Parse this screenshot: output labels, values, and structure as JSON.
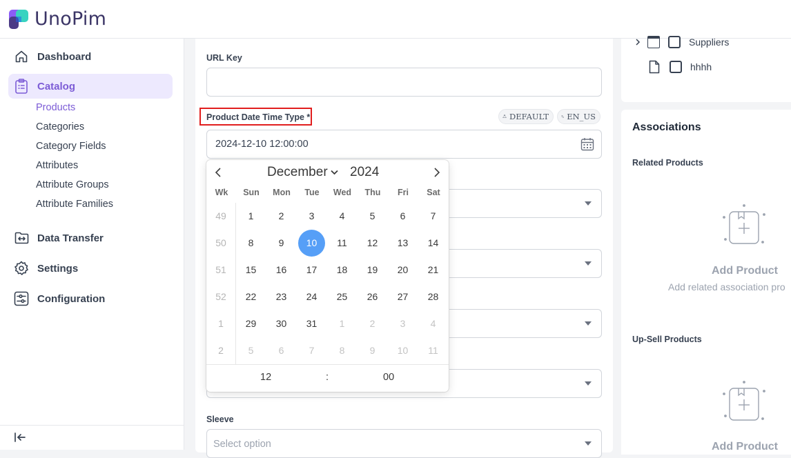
{
  "app": {
    "name": "UnoPim"
  },
  "sidebar": {
    "items": [
      {
        "label": "Dashboard",
        "icon": "home-icon"
      },
      {
        "label": "Catalog",
        "icon": "clipboard-list-icon",
        "active": true,
        "children": [
          {
            "label": "Products",
            "active": true
          },
          {
            "label": "Categories"
          },
          {
            "label": "Category Fields"
          },
          {
            "label": "Attributes"
          },
          {
            "label": "Attribute Groups"
          },
          {
            "label": "Attribute Families"
          }
        ]
      },
      {
        "label": "Data Transfer",
        "icon": "folder-arrows-icon"
      },
      {
        "label": "Settings",
        "icon": "gear-icon"
      },
      {
        "label": "Configuration",
        "icon": "sliders-icon"
      }
    ],
    "collapse_icon": "collapse-left-icon"
  },
  "form": {
    "url_key": {
      "label": "URL Key",
      "value": ""
    },
    "date_time": {
      "label": "Product Date Time Type",
      "required_mark": "*",
      "value": "2024-12-10 12:00:00",
      "badges": {
        "channel": "DEFAULT",
        "locale": "EN_US"
      }
    },
    "sleeve": {
      "label": "Sleeve",
      "placeholder": "Select option"
    }
  },
  "calendar": {
    "month": "December",
    "year": "2024",
    "weekdays": [
      "Wk",
      "Sun",
      "Mon",
      "Tue",
      "Wed",
      "Thu",
      "Fri",
      "Sat"
    ],
    "weeks": [
      {
        "wk": "49",
        "days": [
          "1",
          "2",
          "3",
          "4",
          "5",
          "6",
          "7"
        ]
      },
      {
        "wk": "50",
        "days": [
          "8",
          "9",
          "10",
          "11",
          "12",
          "13",
          "14"
        ]
      },
      {
        "wk": "51",
        "days": [
          "15",
          "16",
          "17",
          "18",
          "19",
          "20",
          "21"
        ]
      },
      {
        "wk": "52",
        "days": [
          "22",
          "23",
          "24",
          "25",
          "26",
          "27",
          "28"
        ]
      },
      {
        "wk": "1",
        "days": [
          "29",
          "30",
          "31",
          "1",
          "2",
          "3",
          "4"
        ]
      },
      {
        "wk": "2",
        "days": [
          "5",
          "6",
          "7",
          "8",
          "9",
          "10",
          "11"
        ]
      }
    ],
    "selected_day": "10",
    "time": {
      "hour": "12",
      "separator": ":",
      "minute": "00"
    }
  },
  "tree": {
    "items": [
      {
        "label": "Suppliers",
        "expandable": true
      },
      {
        "label": "hhhh",
        "expandable": false
      }
    ]
  },
  "associations": {
    "title": "Associations",
    "related": {
      "label": "Related Products",
      "add_label": "Add Product",
      "add_desc": "Add related association pro"
    },
    "upsell": {
      "label": "Up-Sell Products",
      "add_label": "Add Product"
    }
  }
}
